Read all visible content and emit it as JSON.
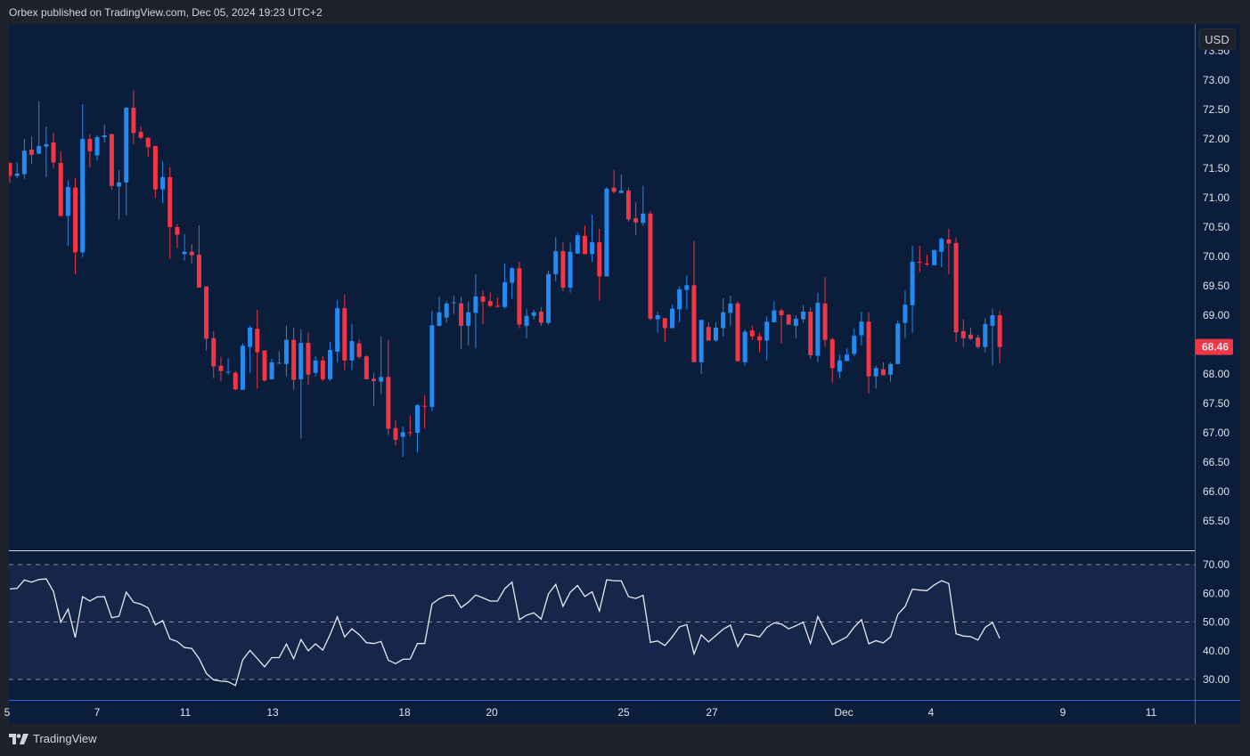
{
  "header": {
    "published": "Orbex published on TradingView.com, Dec 05, 2024 19:23 UTC+2"
  },
  "currency_button": "USD",
  "footer": {
    "brand": "TradingView"
  },
  "colors": {
    "up": "#2489f0",
    "down": "#f23645",
    "background": "#0a1e3c",
    "rsi_line": "#e8eaf0",
    "rsi_band": "#16264b",
    "last_price": "#f23645",
    "axis_line": "#2962ff"
  },
  "chart_data": [
    {
      "type": "candlestick",
      "interval": "4h",
      "ylim": [
        65.5,
        73.5
      ],
      "y_ticks": [
        "73.50",
        "73.00",
        "72.50",
        "72.00",
        "71.50",
        "71.00",
        "70.50",
        "70.00",
        "69.50",
        "69.00",
        "68.50",
        "68.00",
        "67.50",
        "67.00",
        "66.50",
        "66.00",
        "65.50"
      ],
      "hidden_ticks": [
        "68.50"
      ],
      "last_price": "68.46",
      "x_ticks": [
        "5",
        "7",
        "11",
        "13",
        "18",
        "20",
        "25",
        "27",
        "Dec",
        "4",
        "9",
        "11"
      ],
      "ohlc_fields": [
        "open",
        "high",
        "low",
        "close"
      ],
      "candles": [
        [
          71.59,
          71.6,
          71.26,
          71.37
        ],
        [
          71.37,
          71.6,
          71.33,
          71.41
        ],
        [
          71.4,
          72.0,
          71.32,
          71.8
        ],
        [
          71.82,
          72.04,
          71.58,
          71.73
        ],
        [
          71.75,
          72.64,
          71.74,
          71.88
        ],
        [
          71.87,
          72.21,
          71.35,
          71.91
        ],
        [
          71.94,
          72.11,
          71.5,
          71.6
        ],
        [
          71.59,
          71.79,
          70.68,
          70.69
        ],
        [
          70.69,
          71.29,
          70.18,
          71.18
        ],
        [
          71.17,
          71.33,
          69.7,
          70.07
        ],
        [
          70.07,
          72.59,
          69.99,
          72.0
        ],
        [
          72.0,
          72.08,
          71.52,
          71.79
        ],
        [
          71.72,
          72.06,
          71.63,
          72.03
        ],
        [
          72.03,
          72.24,
          71.94,
          72.06
        ],
        [
          72.08,
          72.09,
          71.13,
          71.2
        ],
        [
          71.19,
          71.47,
          70.63,
          71.26
        ],
        [
          71.26,
          72.55,
          70.7,
          72.53
        ],
        [
          72.53,
          72.83,
          71.91,
          72.1
        ],
        [
          72.12,
          72.21,
          71.99,
          72.02
        ],
        [
          72.02,
          72.03,
          71.7,
          71.86
        ],
        [
          71.88,
          71.88,
          71.0,
          71.14
        ],
        [
          71.14,
          71.61,
          70.91,
          71.35
        ],
        [
          71.35,
          71.52,
          69.96,
          70.5
        ],
        [
          70.5,
          70.55,
          70.14,
          70.37
        ],
        [
          70.04,
          70.38,
          69.93,
          70.08
        ],
        [
          70.08,
          70.21,
          69.88,
          70.02
        ],
        [
          70.03,
          70.53,
          69.47,
          69.47
        ],
        [
          69.49,
          69.49,
          68.4,
          68.6
        ],
        [
          68.61,
          68.73,
          67.93,
          68.13
        ],
        [
          68.14,
          68.29,
          67.88,
          68.05
        ],
        [
          68.03,
          68.27,
          67.99,
          68.04
        ],
        [
          68.02,
          68.05,
          67.72,
          67.74
        ],
        [
          67.73,
          68.52,
          67.73,
          68.48
        ],
        [
          68.46,
          68.82,
          68.02,
          68.79
        ],
        [
          68.77,
          69.09,
          67.75,
          68.37
        ],
        [
          68.4,
          68.4,
          67.87,
          67.89
        ],
        [
          67.91,
          68.26,
          67.91,
          68.2
        ],
        [
          68.18,
          68.39,
          68.18,
          68.19
        ],
        [
          68.17,
          68.82,
          67.96,
          68.58
        ],
        [
          68.58,
          68.79,
          67.73,
          67.9
        ],
        [
          67.91,
          68.76,
          66.9,
          68.53
        ],
        [
          68.53,
          68.71,
          67.82,
          67.99
        ],
        [
          68.02,
          68.3,
          67.96,
          68.23
        ],
        [
          68.23,
          68.3,
          67.88,
          67.91
        ],
        [
          67.91,
          68.55,
          67.88,
          68.41
        ],
        [
          68.38,
          69.26,
          68.2,
          69.12
        ],
        [
          69.12,
          69.35,
          68.07,
          68.23
        ],
        [
          68.23,
          68.85,
          68.07,
          68.56
        ],
        [
          68.52,
          68.59,
          68.26,
          68.29
        ],
        [
          68.3,
          68.32,
          67.91,
          67.91
        ],
        [
          67.92,
          68.02,
          67.46,
          67.88
        ],
        [
          67.87,
          68.64,
          67.66,
          67.95
        ],
        [
          67.95,
          68.58,
          66.96,
          67.07
        ],
        [
          67.08,
          67.21,
          66.78,
          66.88
        ],
        [
          66.93,
          67.11,
          66.59,
          67.01
        ],
        [
          67.01,
          67.29,
          66.94,
          67.0
        ],
        [
          67.0,
          67.49,
          66.66,
          67.47
        ],
        [
          67.46,
          67.64,
          67.07,
          67.45
        ],
        [
          67.44,
          69.08,
          67.37,
          68.83
        ],
        [
          68.82,
          69.32,
          68.81,
          69.05
        ],
        [
          68.96,
          69.24,
          68.87,
          69.2
        ],
        [
          69.21,
          69.33,
          69.02,
          69.22
        ],
        [
          69.2,
          69.32,
          68.43,
          68.82
        ],
        [
          68.82,
          69.23,
          68.49,
          69.05
        ],
        [
          69.04,
          69.7,
          68.44,
          69.32
        ],
        [
          69.32,
          69.42,
          68.85,
          69.23
        ],
        [
          69.24,
          69.39,
          69.13,
          69.16
        ],
        [
          69.16,
          69.3,
          69.13,
          69.15
        ],
        [
          69.14,
          69.88,
          69.11,
          69.56
        ],
        [
          69.55,
          69.82,
          69.28,
          69.8
        ],
        [
          69.8,
          69.91,
          68.78,
          68.84
        ],
        [
          68.82,
          69.11,
          68.61,
          68.99
        ],
        [
          68.99,
          69.09,
          68.93,
          69.05
        ],
        [
          69.06,
          69.14,
          68.82,
          68.87
        ],
        [
          68.87,
          69.76,
          68.84,
          69.7
        ],
        [
          69.7,
          70.33,
          69.58,
          70.09
        ],
        [
          70.09,
          70.24,
          69.41,
          69.47
        ],
        [
          69.47,
          70.23,
          69.38,
          70.08
        ],
        [
          70.05,
          70.41,
          70.05,
          70.36
        ],
        [
          70.35,
          70.53,
          70.04,
          70.04
        ],
        [
          70.04,
          70.71,
          69.91,
          70.24
        ],
        [
          70.24,
          70.47,
          69.25,
          69.66
        ],
        [
          69.66,
          71.18,
          69.66,
          71.15
        ],
        [
          71.17,
          71.47,
          71.07,
          71.1
        ],
        [
          71.08,
          71.39,
          71.08,
          71.12
        ],
        [
          71.12,
          71.17,
          70.59,
          70.63
        ],
        [
          70.65,
          70.92,
          70.37,
          70.58
        ],
        [
          70.57,
          71.2,
          70.52,
          70.73
        ],
        [
          70.73,
          70.77,
          68.91,
          68.94
        ],
        [
          68.93,
          69.06,
          68.7,
          69.0
        ],
        [
          68.95,
          68.95,
          68.55,
          68.78
        ],
        [
          68.78,
          69.18,
          68.78,
          69.11
        ],
        [
          69.1,
          69.49,
          68.88,
          69.44
        ],
        [
          69.43,
          69.68,
          69.1,
          69.51
        ],
        [
          69.51,
          70.26,
          68.2,
          68.2
        ],
        [
          68.2,
          68.92,
          68.0,
          68.92
        ],
        [
          68.8,
          68.88,
          68.57,
          68.57
        ],
        [
          68.57,
          68.88,
          68.55,
          68.79
        ],
        [
          68.78,
          69.29,
          68.64,
          69.05
        ],
        [
          69.04,
          69.33,
          68.82,
          69.2
        ],
        [
          69.2,
          69.24,
          68.2,
          68.22
        ],
        [
          68.2,
          68.76,
          68.14,
          68.72
        ],
        [
          68.74,
          68.82,
          68.58,
          68.64
        ],
        [
          68.64,
          68.7,
          68.37,
          68.57
        ],
        [
          68.57,
          68.98,
          68.23,
          68.89
        ],
        [
          68.88,
          69.24,
          68.88,
          69.08
        ],
        [
          69.08,
          69.11,
          68.52,
          69.0
        ],
        [
          69.01,
          69.01,
          68.84,
          68.84
        ],
        [
          68.82,
          69.0,
          68.61,
          68.94
        ],
        [
          68.93,
          69.17,
          68.87,
          69.06
        ],
        [
          69.06,
          69.14,
          68.26,
          68.32
        ],
        [
          68.31,
          69.38,
          68.2,
          69.21
        ],
        [
          69.2,
          69.65,
          68.46,
          68.58
        ],
        [
          68.59,
          68.62,
          67.85,
          68.1
        ],
        [
          68.04,
          68.33,
          67.93,
          68.23
        ],
        [
          68.22,
          68.44,
          68.22,
          68.33
        ],
        [
          68.34,
          68.77,
          68.31,
          68.65
        ],
        [
          68.66,
          69.06,
          68.49,
          68.89
        ],
        [
          68.89,
          69.05,
          67.67,
          67.96
        ],
        [
          67.96,
          68.14,
          67.75,
          68.1
        ],
        [
          68.08,
          68.2,
          67.98,
          67.98
        ],
        [
          67.99,
          68.2,
          67.87,
          68.17
        ],
        [
          68.17,
          68.91,
          68.17,
          68.86
        ],
        [
          68.87,
          69.42,
          68.61,
          69.18
        ],
        [
          69.17,
          70.18,
          68.7,
          69.91
        ],
        [
          69.91,
          70.18,
          69.73,
          69.9
        ],
        [
          69.88,
          70.03,
          69.84,
          69.87
        ],
        [
          69.85,
          70.11,
          69.85,
          70.11
        ],
        [
          70.08,
          70.32,
          69.82,
          70.3
        ],
        [
          70.29,
          70.47,
          69.7,
          70.22
        ],
        [
          70.23,
          70.32,
          68.54,
          68.71
        ],
        [
          68.73,
          68.93,
          68.46,
          68.61
        ],
        [
          68.67,
          68.79,
          68.58,
          68.6
        ],
        [
          68.62,
          68.67,
          68.43,
          68.46
        ],
        [
          68.46,
          68.95,
          68.37,
          68.85
        ],
        [
          68.82,
          69.11,
          68.15,
          69.0
        ],
        [
          69.0,
          69.08,
          68.19,
          68.46
        ]
      ]
    },
    {
      "type": "line",
      "ylim": [
        25,
        72
      ],
      "y_ticks": [
        "70.00",
        "60.00",
        "50.00",
        "40.00",
        "30.00"
      ],
      "levels": [
        70,
        50,
        30
      ],
      "values": [
        61.5,
        61.7,
        64.6,
        63.9,
        64.8,
        65.0,
        60.6,
        49.9,
        54.5,
        44.6,
        58.8,
        57.3,
        58.7,
        58.8,
        51.5,
        52.0,
        60.4,
        56.9,
        56.2,
        54.9,
        49.0,
        50.5,
        44.1,
        43.2,
        41.1,
        40.8,
        37.3,
        32.1,
        29.8,
        29.4,
        29.2,
        27.9,
        36.8,
        40.1,
        37.3,
        34.4,
        37.6,
        37.6,
        42.3,
        37.2,
        43.9,
        40.0,
        42.4,
        40.2,
        45.6,
        51.8,
        44.8,
        47.6,
        45.6,
        42.8,
        42.5,
        43.2,
        36.7,
        35.5,
        37.0,
        37.1,
        42.5,
        42.5,
        56.3,
        58.1,
        59.2,
        59.3,
        55.0,
        56.9,
        59.4,
        58.4,
        57.3,
        57.3,
        61.6,
        63.9,
        50.8,
        52.4,
        53.2,
        51.0,
        59.8,
        63.1,
        55.5,
        60.4,
        62.7,
        58.9,
        60.5,
        53.8,
        64.7,
        64.4,
        64.3,
        58.8,
        58.2,
        59.3,
        42.9,
        43.4,
        41.8,
        44.8,
        48.3,
        49.1,
        38.9,
        45.5,
        43.1,
        45.3,
        47.5,
        48.9,
        41.4,
        45.8,
        45.4,
        44.8,
        48.1,
        49.7,
        49.3,
        47.6,
        48.7,
        49.9,
        42.5,
        51.9,
        47.0,
        42.2,
        43.5,
        44.8,
        48.2,
        50.8,
        42.4,
        43.5,
        42.7,
        44.8,
        52.6,
        55.4,
        61.4,
        61.1,
        60.9,
        62.9,
        64.4,
        63.4,
        45.9,
        45.1,
        44.9,
        43.7,
        48.1,
        49.8,
        44.3
      ]
    }
  ]
}
